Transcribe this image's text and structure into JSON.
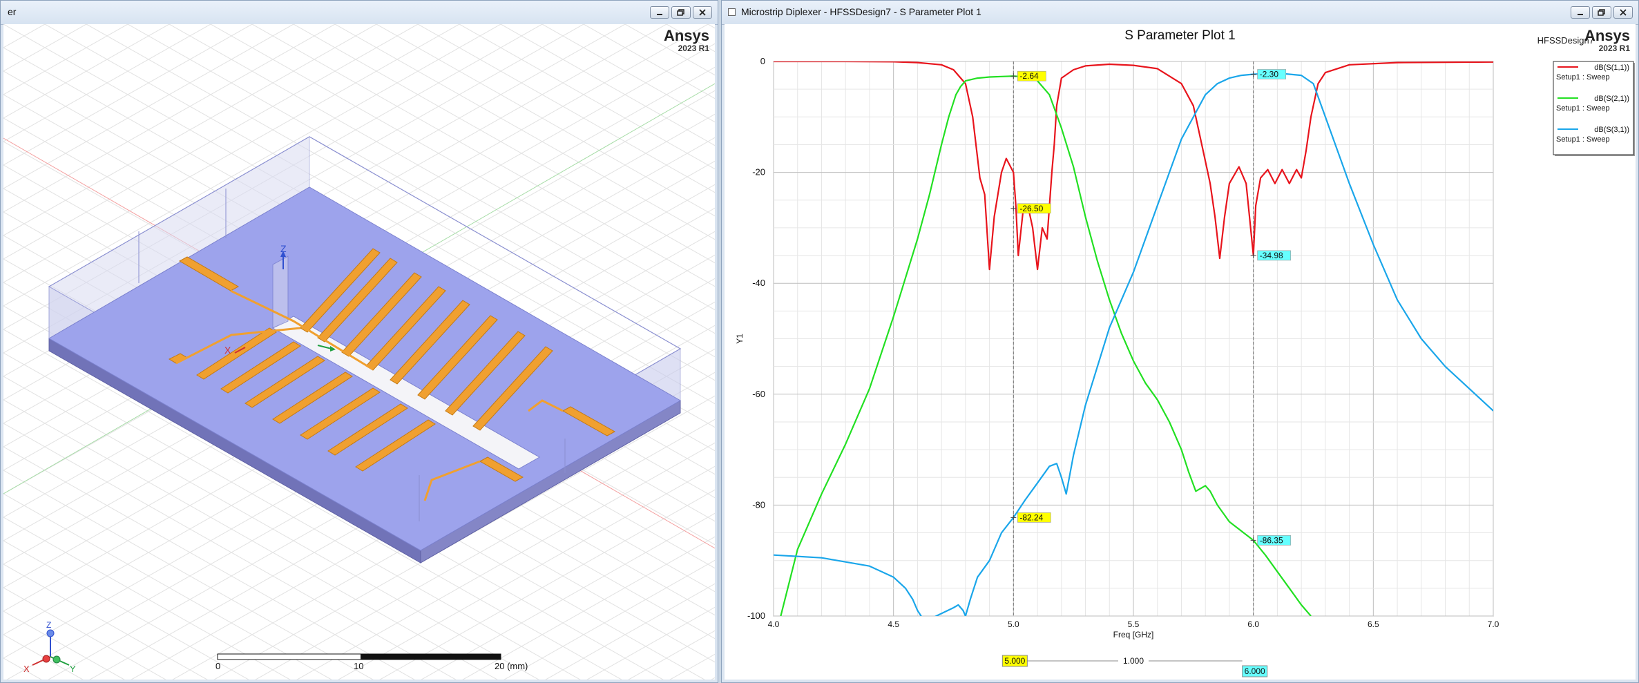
{
  "left_window": {
    "title": "er",
    "brand": {
      "name": "Ansys",
      "version": "2023 R1"
    },
    "axes_triad": {
      "z": "Z",
      "x": "X",
      "y": "Y"
    },
    "model_axes": {
      "z": "Z",
      "x": "X"
    },
    "scale_bar": {
      "ticks": [
        "0",
        "10",
        "20 (mm)"
      ]
    }
  },
  "right_window": {
    "title": "Microstrip Diplexer - HFSSDesign7 - S Parameter Plot 1",
    "brand": {
      "name": "Ansys",
      "version": "2023 R1"
    },
    "design_name": "HFSSDesign7"
  },
  "colors": {
    "s11": "#e8141c",
    "s21": "#22e022",
    "s31": "#1aa6ea",
    "substrate": "#9da3ec",
    "trace": "#f0a030"
  },
  "chart_data": {
    "type": "line",
    "title": "S Parameter Plot 1",
    "xlabel": "Freq [GHz]",
    "ylabel": "Y1",
    "xlim": [
      4.0,
      7.0
    ],
    "ylim": [
      -100,
      0
    ],
    "xticks": [
      "4.0",
      "4.5",
      "5.0",
      "5.5",
      "6.0",
      "6.5",
      "7.0"
    ],
    "yticks": [
      "0",
      "-20",
      "-40",
      "-60",
      "-80",
      "-100"
    ],
    "grid": true,
    "legend_position": "top-right",
    "series": [
      {
        "name": "dB(S(1,1))",
        "setup": "Setup1 : Sweep",
        "color": "#e8141c",
        "x": [
          4.0,
          4.3,
          4.5,
          4.6,
          4.7,
          4.75,
          4.8,
          4.83,
          4.86,
          4.88,
          4.9,
          4.92,
          4.95,
          4.97,
          5.0,
          5.01,
          5.02,
          5.04,
          5.06,
          5.08,
          5.1,
          5.12,
          5.14,
          5.16,
          5.17,
          5.18,
          5.2,
          5.25,
          5.3,
          5.4,
          5.5,
          5.6,
          5.7,
          5.75,
          5.8,
          5.82,
          5.84,
          5.86,
          5.88,
          5.9,
          5.94,
          5.97,
          6.0,
          6.01,
          6.03,
          6.06,
          6.09,
          6.12,
          6.15,
          6.18,
          6.2,
          6.22,
          6.24,
          6.27,
          6.3,
          6.4,
          6.6,
          7.0
        ],
        "y": [
          0,
          0,
          -0.05,
          -0.2,
          -0.6,
          -1.5,
          -4,
          -10,
          -21,
          -24,
          -37.5,
          -28,
          -20,
          -17.5,
          -20,
          -26,
          -35,
          -27,
          -26,
          -30,
          -37.5,
          -30,
          -32,
          -20,
          -15,
          -8,
          -3,
          -1.5,
          -0.8,
          -0.5,
          -0.7,
          -1.3,
          -4,
          -8,
          -18,
          -22,
          -28,
          -35.5,
          -28,
          -22,
          -19,
          -22,
          -34.98,
          -26,
          -21,
          -19.5,
          -22,
          -19.5,
          -22,
          -19.5,
          -21,
          -16,
          -10,
          -4,
          -2,
          -0.6,
          -0.2,
          -0.1
        ]
      },
      {
        "name": "dB(S(2,1))",
        "setup": "Setup1 : Sweep",
        "color": "#22e022",
        "x": [
          4.03,
          4.1,
          4.2,
          4.3,
          4.4,
          4.5,
          4.6,
          4.65,
          4.7,
          4.73,
          4.76,
          4.78,
          4.8,
          4.85,
          4.9,
          5.0,
          5.05,
          5.08,
          5.1,
          5.15,
          5.2,
          5.25,
          5.3,
          5.35,
          5.4,
          5.45,
          5.5,
          5.55,
          5.6,
          5.65,
          5.7,
          5.73,
          5.76,
          5.78,
          5.8,
          5.82,
          5.85,
          5.9,
          6.0,
          6.05,
          6.1,
          6.15,
          6.2,
          6.24
        ],
        "y": [
          -100,
          -88,
          -78,
          -69,
          -59,
          -46,
          -32,
          -24,
          -15,
          -10,
          -6,
          -4.5,
          -3.5,
          -3,
          -2.8,
          -2.64,
          -2.8,
          -3,
          -3.5,
          -6,
          -12,
          -19,
          -28,
          -36,
          -43,
          -49,
          -54,
          -58,
          -61,
          -65,
          -70,
          -74,
          -77.5,
          -77,
          -76.5,
          -77.5,
          -80,
          -83,
          -86.35,
          -89,
          -92,
          -95,
          -98,
          -100
        ]
      },
      {
        "name": "dB(S(3,1))",
        "setup": "Setup1 : Sweep",
        "color": "#1aa6ea",
        "x": [
          4.0,
          4.2,
          4.4,
          4.5,
          4.55,
          4.58,
          4.6,
          4.63,
          4.75,
          4.77,
          4.79,
          4.8,
          4.82,
          4.85,
          4.9,
          4.95,
          5.0,
          5.05,
          5.1,
          5.15,
          5.18,
          5.2,
          5.22,
          5.25,
          5.3,
          5.35,
          5.4,
          5.5,
          5.6,
          5.7,
          5.8,
          5.85,
          5.9,
          5.95,
          6.0,
          6.1,
          6.2,
          6.25,
          6.3,
          6.4,
          6.5,
          6.6,
          6.7,
          6.8,
          6.9,
          7.0
        ],
        "y": [
          -89,
          -89.5,
          -91,
          -93,
          -95,
          -97,
          -99,
          -101,
          -98.5,
          -98,
          -99,
          -100,
          -97,
          -93,
          -90,
          -85,
          -82.24,
          -79,
          -76,
          -73,
          -72.5,
          -75,
          -78,
          -71,
          -62,
          -55,
          -48,
          -38,
          -26,
          -14,
          -6,
          -4,
          -3,
          -2.5,
          -2.3,
          -2.1,
          -2.5,
          -4,
          -10,
          -22,
          -33,
          -43,
          -50,
          -55,
          -59,
          -63
        ]
      }
    ],
    "markers": [
      {
        "label": "-2.64",
        "x": 5.0,
        "y": -2.64,
        "color": "#ffff00"
      },
      {
        "label": "-26.50",
        "x": 5.0,
        "y": -26.5,
        "color": "#ffff00"
      },
      {
        "label": "-82.24",
        "x": 5.0,
        "y": -82.24,
        "color": "#ffff00"
      },
      {
        "label": "-2.30",
        "x": 6.0,
        "y": -2.3,
        "color": "#66ffff"
      },
      {
        "label": "-34.98",
        "x": 6.0,
        "y": -34.98,
        "color": "#66ffff"
      },
      {
        "label": "-86.35",
        "x": 6.0,
        "y": -86.35,
        "color": "#66ffff"
      }
    ],
    "marker_lines": [
      5.0,
      6.0
    ],
    "delta": {
      "x1_label": "5.000",
      "x2_label": "6.000",
      "delta_label": "1.000"
    }
  }
}
